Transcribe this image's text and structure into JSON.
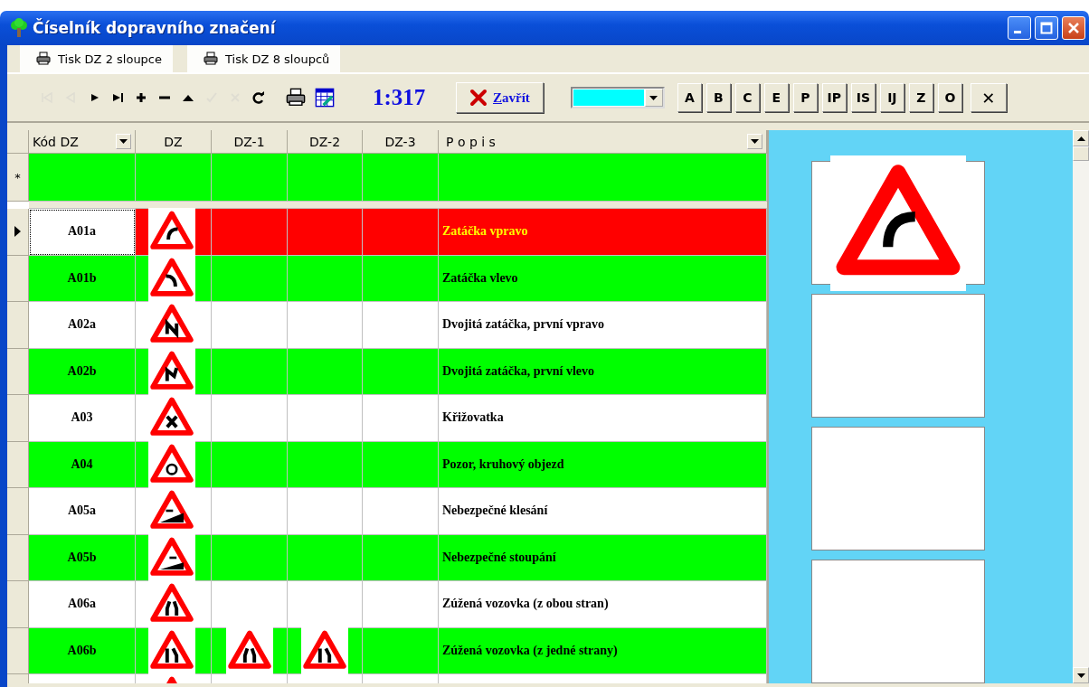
{
  "window": {
    "title": "Číselník dopravního značení"
  },
  "print_buttons": [
    {
      "label": "Tisk DZ 2 sloupce"
    },
    {
      "label": "Tisk DZ 8 sloupců"
    }
  ],
  "toolbar": {
    "nav": [
      {
        "kind": "first",
        "disabled": true
      },
      {
        "kind": "prev",
        "disabled": true
      },
      {
        "kind": "next",
        "disabled": false
      },
      {
        "kind": "last",
        "disabled": false
      },
      {
        "kind": "add",
        "disabled": false
      },
      {
        "kind": "delete",
        "disabled": false
      },
      {
        "kind": "edit",
        "disabled": false
      },
      {
        "kind": "post",
        "disabled": true
      },
      {
        "kind": "cancel",
        "disabled": true
      },
      {
        "kind": "refresh",
        "disabled": false
      },
      {
        "kind": "print",
        "disabled": false
      },
      {
        "kind": "export",
        "disabled": false
      }
    ],
    "record": "1:317",
    "close_label": "Zavřít",
    "color_filter": {
      "color": "#00ffff"
    },
    "letters": [
      "A",
      "B",
      "C",
      "E",
      "P",
      "IP",
      "IS",
      "IJ",
      "Z",
      "O"
    ],
    "clear": "✕"
  },
  "grid": {
    "columns": [
      {
        "label": "Kód DZ",
        "filter": true
      },
      {
        "label": "DZ",
        "filter": false
      },
      {
        "label": "DZ-1",
        "filter": false
      },
      {
        "label": "DZ-2",
        "filter": false
      },
      {
        "label": "DZ-3",
        "filter": false
      },
      {
        "label": "P o p i s",
        "filter": true
      }
    ],
    "new_row": {
      "marker": "*"
    },
    "rows": [
      {
        "code": "A01a",
        "description": "Zatáčka vpravo",
        "images": [
          true,
          false,
          false
        ],
        "selected": true
      },
      {
        "code": "A01b",
        "description": "Zatáčka vlevo",
        "images": [
          true,
          false,
          false
        ],
        "selected": false
      },
      {
        "code": "A02a",
        "description": "Dvojitá zatáčka, první vpravo",
        "images": [
          true,
          false,
          false
        ],
        "selected": false
      },
      {
        "code": "A02b",
        "description": "Dvojitá zatáčka, první vlevo",
        "images": [
          true,
          false,
          false
        ],
        "selected": false
      },
      {
        "code": "A03",
        "description": "Křižovatka",
        "images": [
          true,
          false,
          false
        ],
        "selected": false
      },
      {
        "code": "A04",
        "description": "Pozor, kruhový objezd",
        "images": [
          true,
          false,
          false
        ],
        "selected": false
      },
      {
        "code": "A05a",
        "description": "Nebezpečné klesání",
        "images": [
          true,
          false,
          false
        ],
        "selected": false
      },
      {
        "code": "A05b",
        "description": "Nebezpečné stoupání",
        "images": [
          true,
          false,
          false
        ],
        "selected": false
      },
      {
        "code": "A06a",
        "description": "Zúžená vozovka (z obou stran)",
        "images": [
          true,
          false,
          false
        ],
        "selected": false
      },
      {
        "code": "A06b",
        "description": "Zúžená vozovka (z jedné strany)",
        "images": [
          true,
          true,
          true
        ],
        "selected": false
      },
      {
        "images": [
          true,
          false,
          false
        ],
        "selected": false
      }
    ]
  },
  "preview": {
    "slots": [
      {
        "filled": true
      },
      {
        "filled": false
      },
      {
        "filled": false
      },
      {
        "filled": false
      }
    ]
  }
}
